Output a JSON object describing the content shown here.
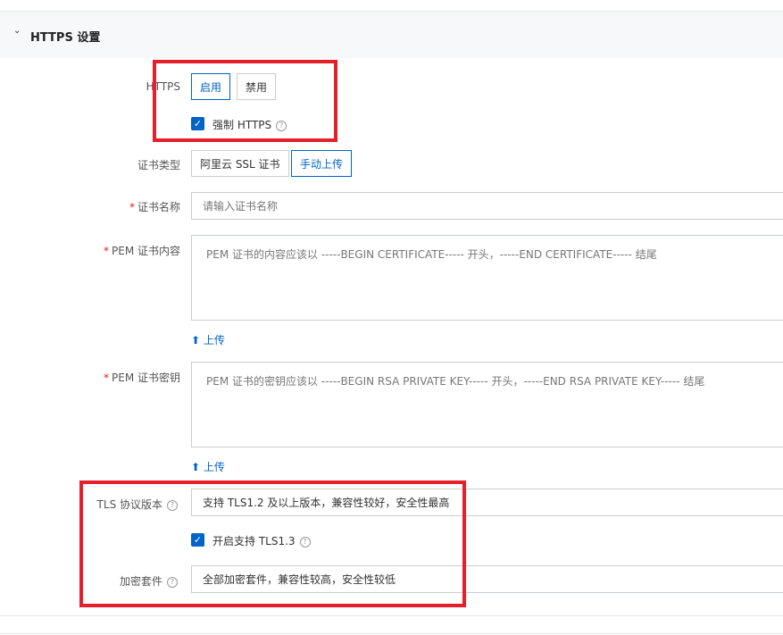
{
  "section": {
    "title": "HTTPS 设置",
    "chevron": "chevron-down-icon"
  },
  "https": {
    "label": "HTTPS",
    "enable": "启用",
    "disable": "禁用",
    "force_label": "强制 HTTPS",
    "force_checked": true
  },
  "cert_type": {
    "label": "证书类型",
    "options": [
      "阿里云 SSL 证书",
      "手动上传"
    ],
    "selected": "手动上传"
  },
  "cert_name": {
    "label": "证书名称",
    "placeholder": "请输入证书名称"
  },
  "pem_content": {
    "label": "PEM 证书内容",
    "placeholder": "PEM 证书的内容应该以 -----BEGIN CERTIFICATE----- 开头，-----END CERTIFICATE----- 结尾",
    "upload": "上传"
  },
  "pem_key": {
    "label": "PEM 证书密钥",
    "placeholder": "PEM 证书的密钥应该以 -----BEGIN RSA PRIVATE KEY----- 开头，-----END RSA PRIVATE KEY----- 结尾",
    "upload": "上传"
  },
  "tls": {
    "label": "TLS 协议版本",
    "value": "支持 TLS1.2 及以上版本，兼容性较好，安全性最高",
    "tls13_label": "开启支持 TLS1.3",
    "tls13_checked": true
  },
  "cipher": {
    "label": "加密套件",
    "value": "全部加密套件，兼容性较高，安全性较低"
  },
  "colors": {
    "accent": "#0064c8",
    "highlight": "#e5202a"
  }
}
